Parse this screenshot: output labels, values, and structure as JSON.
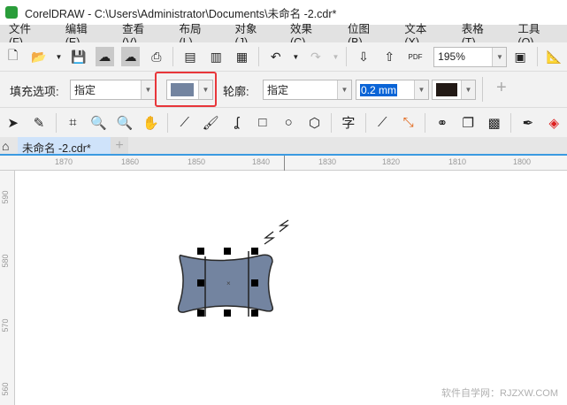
{
  "window": {
    "title": "CorelDRAW - C:\\Users\\Administrator\\Documents\\未命名 -2.cdr*"
  },
  "menu": [
    "文件(F)",
    "编辑(E)",
    "查看(V)",
    "布局(L)",
    "对象(J)",
    "效果(C)",
    "位图(B)",
    "文本(X)",
    "表格(T)",
    "工具(O)"
  ],
  "toolbar": {
    "zoom_value": "195%",
    "pdf_label": "PDF"
  },
  "property_bar": {
    "fill_label": "填充选项:",
    "fill_type": "指定",
    "fill_color": "#7384a0",
    "outline_label": "轮廓:",
    "outline_type": "指定",
    "outline_width": "0.2 mm",
    "outline_color": "#231a16",
    "add_label": "+",
    "highlight_color": "#e8363a"
  },
  "toolbox": {
    "text_tool": "字"
  },
  "tabs": {
    "document": "未命名 -2.cdr*",
    "add": "+"
  },
  "ruler": {
    "h_labels": [
      "1870",
      "1860",
      "1850",
      "1840",
      "1830",
      "1820",
      "1810",
      "1800"
    ],
    "v_labels": [
      "590",
      "580",
      "570",
      "560"
    ]
  },
  "canvas": {
    "sleep_text": "Z Z",
    "shape_fill": "#7384a0"
  },
  "watermark": "软件自学网：RJZXW.COM"
}
